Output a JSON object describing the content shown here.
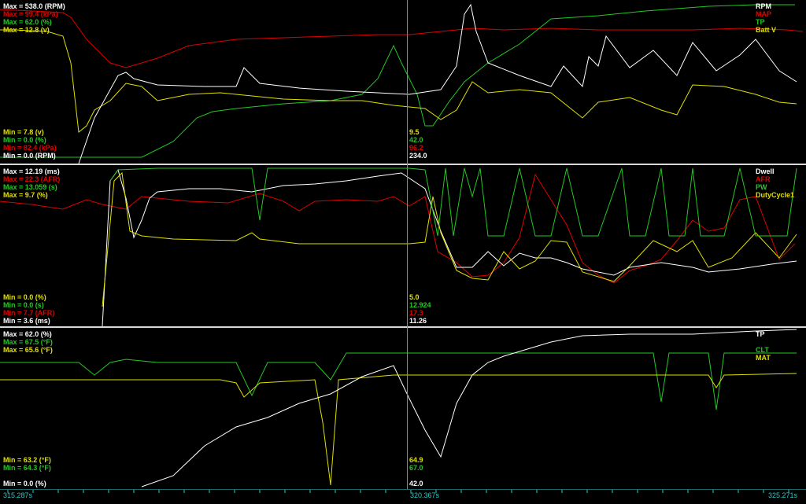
{
  "colors": {
    "white": "#ffffff",
    "red": "#e00000",
    "green": "#22c922",
    "yellow": "#e0e000",
    "cyan": "#2ec8c8"
  },
  "panel1": {
    "max_labels": [
      {
        "text": "Max = 538.0 (RPM)",
        "color": "#ffffff"
      },
      {
        "text": "Max = 99.4 (kPa)",
        "color": "#e00000"
      },
      {
        "text": "Max = 62.0 (%)",
        "color": "#22c922"
      },
      {
        "text": "Max = 12.8 (v)",
        "color": "#e0e000"
      }
    ],
    "min_labels": [
      {
        "text": "Min = 7.8 (v)",
        "color": "#e0e000"
      },
      {
        "text": "Min = 0.0 (%)",
        "color": "#22c922"
      },
      {
        "text": "Min = 82.4 (kPa)",
        "color": "#e00000"
      },
      {
        "text": "Min = 0.0 (RPM)",
        "color": "#ffffff"
      }
    ],
    "cursor_values": [
      {
        "text": "9.5",
        "color": "#e0e000"
      },
      {
        "text": "42.0",
        "color": "#22c922"
      },
      {
        "text": "96.2",
        "color": "#e00000"
      },
      {
        "text": "234.0",
        "color": "#ffffff"
      }
    ],
    "legend": [
      {
        "text": "RPM",
        "color": "#ffffff"
      },
      {
        "text": "MAP",
        "color": "#e00000"
      },
      {
        "text": "TP",
        "color": "#22c922"
      },
      {
        "text": "Batt V",
        "color": "#e0e000"
      }
    ]
  },
  "panel2": {
    "max_labels": [
      {
        "text": "Max = 12.19 (ms)",
        "color": "#ffffff"
      },
      {
        "text": "Max = 22.3 (AFR)",
        "color": "#e00000"
      },
      {
        "text": "Max = 13.059 (s)",
        "color": "#22c922"
      },
      {
        "text": "Max = 9.7 (%)",
        "color": "#e0e000"
      }
    ],
    "min_labels": [
      {
        "text": "Min = 0.0 (%)",
        "color": "#e0e000"
      },
      {
        "text": "Min = 0.0 (s)",
        "color": "#22c922"
      },
      {
        "text": "Min = 7.7 (AFR)",
        "color": "#e00000"
      },
      {
        "text": "Min = 3.6 (ms)",
        "color": "#ffffff"
      }
    ],
    "cursor_values": [
      {
        "text": "5.0",
        "color": "#e0e000"
      },
      {
        "text": "12.924",
        "color": "#22c922"
      },
      {
        "text": "17.3",
        "color": "#e00000"
      },
      {
        "text": "11.26",
        "color": "#ffffff"
      }
    ],
    "legend": [
      {
        "text": "Dwell",
        "color": "#ffffff"
      },
      {
        "text": "AFR",
        "color": "#e00000"
      },
      {
        "text": "PW",
        "color": "#22c922"
      },
      {
        "text": "DutyCycle1",
        "color": "#e0e000"
      }
    ]
  },
  "panel3": {
    "max_labels": [
      {
        "text": "Max = 62.0 (%)",
        "color": "#ffffff"
      },
      {
        "text": "Max = 67.5 (°F)",
        "color": "#22c922"
      },
      {
        "text": "Max = 65.6 (°F)",
        "color": "#e0e000"
      }
    ],
    "min_labels": [
      {
        "text": "Min = 63.2 (°F)",
        "color": "#e0e000"
      },
      {
        "text": "Min = 64.3 (°F)",
        "color": "#22c922"
      },
      {
        "text": "",
        "color": "#000000"
      },
      {
        "text": "Min = 0.0 (%)",
        "color": "#ffffff"
      }
    ],
    "cursor_values": [
      {
        "text": "64.9",
        "color": "#e0e000"
      },
      {
        "text": "67.0",
        "color": "#22c922"
      },
      {
        "text": "",
        "color": "#000000"
      },
      {
        "text": "42.0",
        "color": "#ffffff"
      }
    ],
    "legend": [
      {
        "text": "TP",
        "color": "#ffffff"
      },
      {
        "text": "",
        "color": "#000000"
      },
      {
        "text": "CLT",
        "color": "#22c922"
      },
      {
        "text": "MAT",
        "color": "#e0e000"
      }
    ]
  },
  "timeline": {
    "start": "315.287s",
    "cursor": "320.367s",
    "end": "325.271s"
  }
}
